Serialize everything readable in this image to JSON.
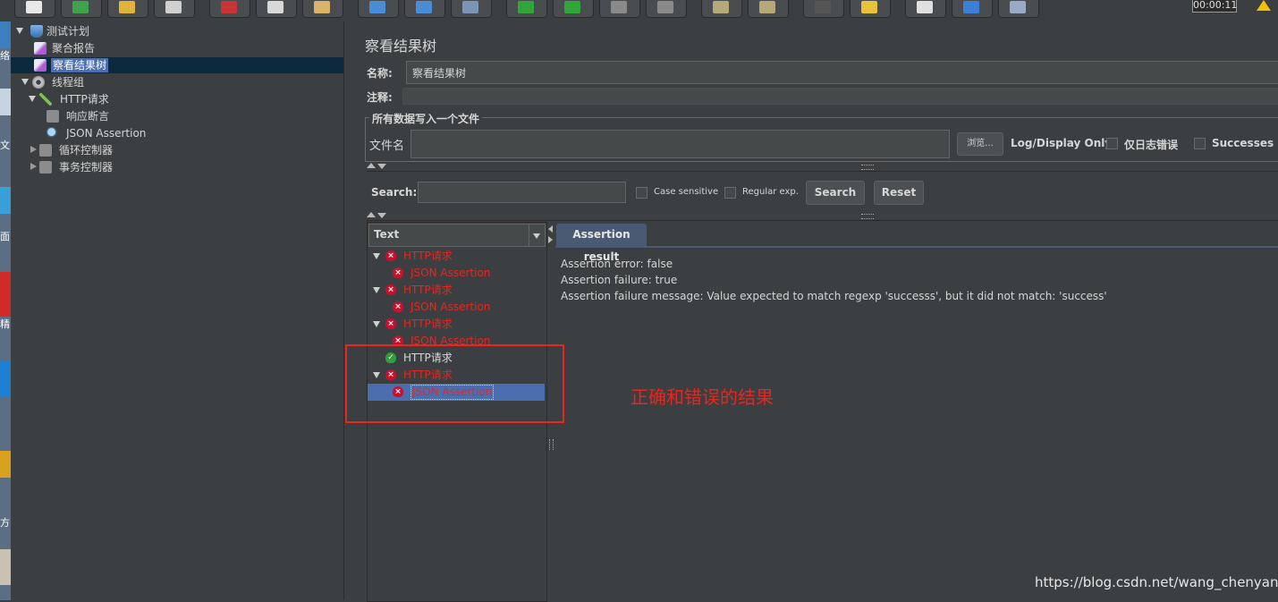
{
  "toolbar": {
    "timer": "00:00:11"
  },
  "desktop_strip": {
    "fragments": [
      "络",
      "文",
      "面",
      "精",
      "方"
    ]
  },
  "test_tree": {
    "items": [
      {
        "label": "测试计划",
        "icon": "flask-icon"
      },
      {
        "label": "聚合报告",
        "icon": "chart-icon"
      },
      {
        "label": "察看结果树",
        "icon": "chart-icon"
      },
      {
        "label": "线程组",
        "icon": "gear-icon"
      },
      {
        "label": "HTTP请求",
        "icon": "pipette-icon"
      },
      {
        "label": "响应断言",
        "icon": "assertion-icon"
      },
      {
        "label": "JSON Assertion",
        "icon": "magnifier-icon"
      },
      {
        "label": "循环控制器",
        "icon": "controller-icon"
      },
      {
        "label": "事务控制器",
        "icon": "controller-icon"
      }
    ]
  },
  "panel": {
    "title": "察看结果树",
    "name_label": "名称:",
    "name_value": "察看结果树",
    "comment_label": "注释:",
    "comment_value": "",
    "file_section_label": "所有数据写入一个文件",
    "filename_label": "文件名",
    "filename_value": "",
    "browse_label": "浏览...",
    "log_display_label": "Log/Display Only:",
    "errors_only_label": "仅日志错误",
    "successes_label": "Successes"
  },
  "search": {
    "label": "Search:",
    "value": "",
    "case_sensitive_label": "Case sensitive",
    "regex_label": "Regular exp.",
    "search_button": "Search",
    "reset_button": "Reset"
  },
  "results": {
    "renderer": "Text",
    "rows": [
      {
        "label": "HTTP请求",
        "status": "error",
        "level": 0
      },
      {
        "label": "JSON Assertion",
        "status": "error",
        "level": 1
      },
      {
        "label": "HTTP请求",
        "status": "error",
        "level": 0
      },
      {
        "label": "JSON Assertion",
        "status": "error",
        "level": 1
      },
      {
        "label": "HTTP请求",
        "status": "error",
        "level": 0
      },
      {
        "label": "JSON Assertion",
        "status": "error",
        "level": 1
      },
      {
        "label": "HTTP请求",
        "status": "success",
        "level": 0
      },
      {
        "label": "HTTP请求",
        "status": "error",
        "level": 0
      },
      {
        "label": "JSON Assertion",
        "status": "error",
        "level": 1
      }
    ],
    "selected_index": 8
  },
  "detail": {
    "tab": "Assertion result",
    "lines": [
      "Assertion error: false",
      "Assertion failure: true",
      "Assertion failure message: Value expected to match regexp 'successs', but it did not match: 'success'"
    ]
  },
  "annotation": {
    "text": "正确和错误的结果",
    "color": "#e8251e"
  },
  "watermark": "https://blog.csdn.net/wang_chenyang",
  "colors": {
    "error_text": "#e8251e",
    "selection_bg": "#4b6eaf"
  }
}
